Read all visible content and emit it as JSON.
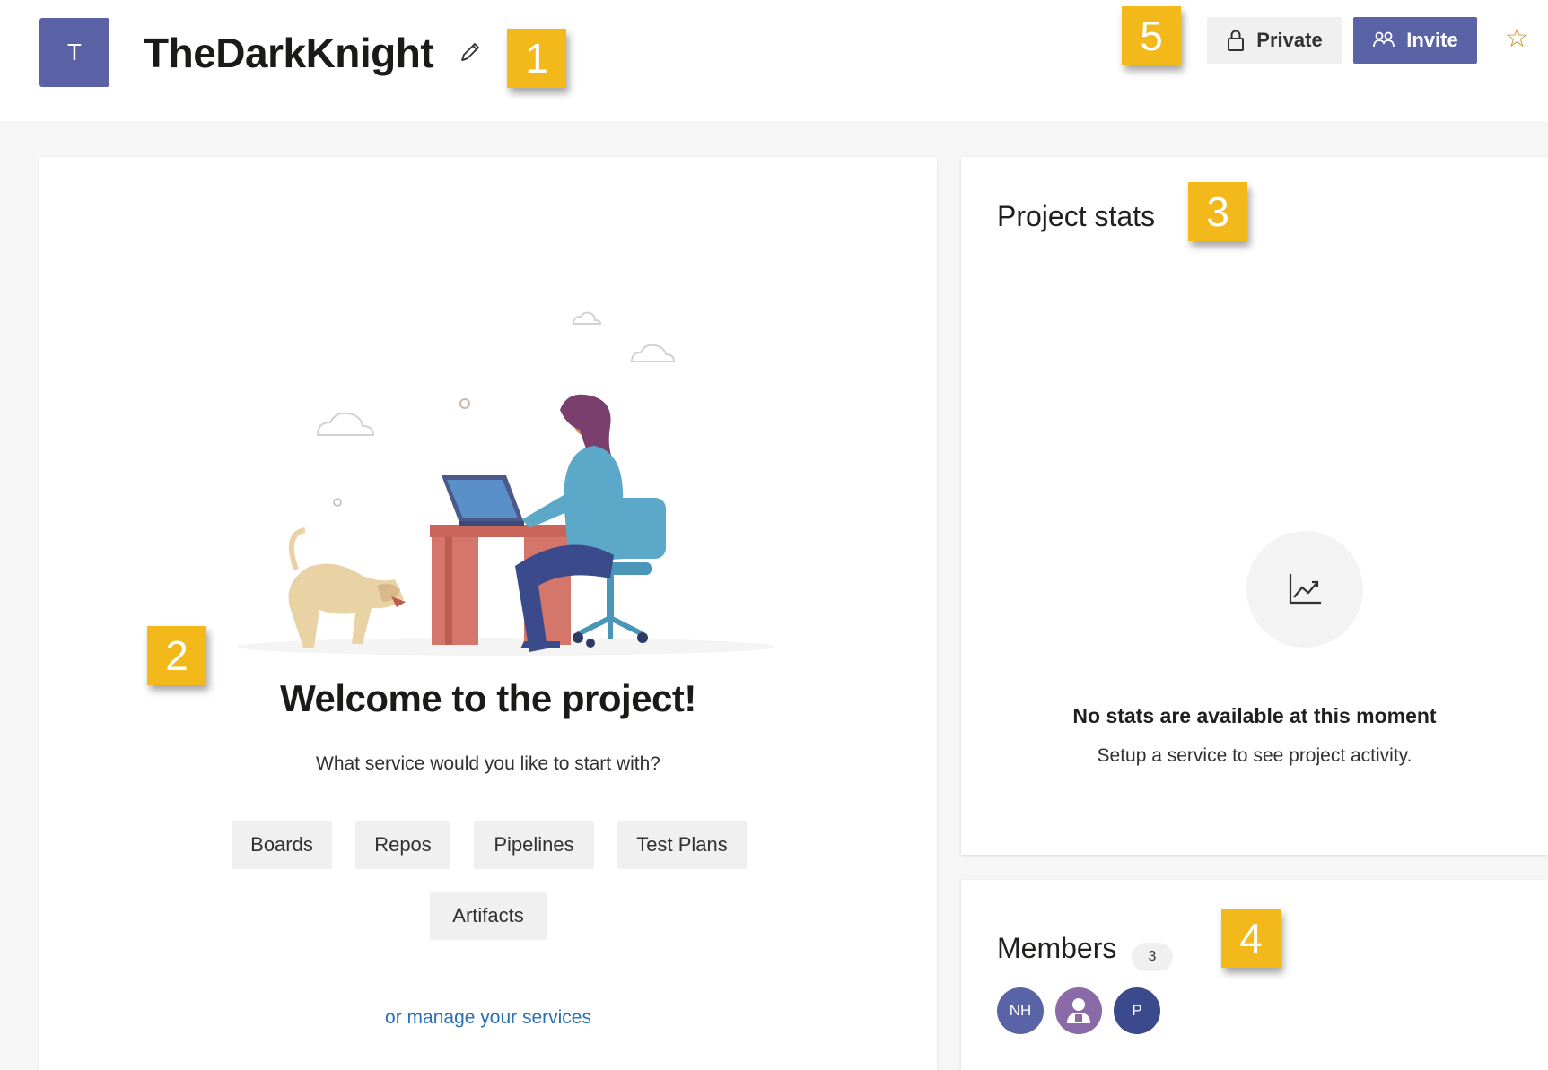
{
  "header": {
    "project_initial": "T",
    "project_name": "TheDarkKnight",
    "private_label": "Private",
    "invite_label": "Invite"
  },
  "callouts": [
    "1",
    "2",
    "3",
    "4",
    "5"
  ],
  "welcome": {
    "title": "Welcome to the project!",
    "subtitle": "What service would you like to start with?",
    "services": [
      "Boards",
      "Repos",
      "Pipelines",
      "Test Plans",
      "Artifacts"
    ],
    "manage_link": "or manage your services"
  },
  "stats": {
    "title": "Project stats",
    "empty_title": "No stats are available at this moment",
    "empty_subtitle": "Setup a service to see project activity."
  },
  "members": {
    "title": "Members",
    "count": "3",
    "avatars": [
      {
        "initials": "NH",
        "color": "#5a63a6"
      },
      {
        "initials": "",
        "color": "#8a6aa7"
      },
      {
        "initials": "P",
        "color": "#3a4a8c"
      }
    ]
  },
  "colors": {
    "accent": "#5a63a6",
    "callout": "#f3b81a",
    "link": "#2a6fb8",
    "star": "#c98e1b"
  },
  "icons": [
    "pencil-icon",
    "lock-icon",
    "invite-people-icon",
    "star-icon",
    "trend-chart-icon",
    "user-icon"
  ]
}
